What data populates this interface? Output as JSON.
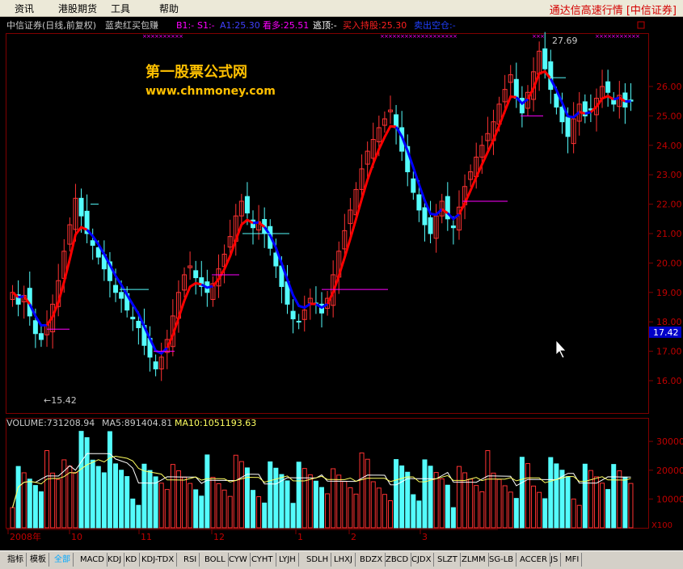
{
  "menu": {
    "items": [
      "资讯",
      "港股期货",
      "工具",
      "帮助"
    ],
    "brand": "通达信高速行情 [中信证券]"
  },
  "header": {
    "stock": "中信证券(日线,前复权)",
    "formula": "蓝卖红买包赚",
    "b1": "B1:-",
    "s1": "S1:-",
    "a1": "A1:25.30",
    "kanduo": "看多:25.51",
    "taoding": "逃顶:-",
    "mairu": "买入持股:25.30",
    "maichu": "卖出空仓:-"
  },
  "watermark": {
    "line1": "第一股票公式网",
    "line2": "www.chnmoney.com"
  },
  "annotations": {
    "high": "27.69",
    "low": "←15.42",
    "last_price": "17.42"
  },
  "price_axis": {
    "ticks": [
      "26.00",
      "25.00",
      "24.00",
      "23.00",
      "22.00",
      "21.00",
      "20.00",
      "19.00",
      "18.00",
      "17.00",
      "16.00"
    ]
  },
  "volume_header": {
    "volume": "VOLUME:731208.94",
    "ma5": "MA5:891404.81",
    "ma10": "MA10:1051193.63"
  },
  "volume_axis": {
    "ticks": [
      "30000",
      "20000",
      "10000"
    ],
    "unit": "X100"
  },
  "time_axis": {
    "labels": [
      "2008年",
      "10",
      "11",
      "12",
      "1",
      "2",
      "3"
    ]
  },
  "tabs": [
    "指标",
    "模板",
    "全部",
    "MACD",
    "KDJ",
    "KD",
    "KDJ-TDX",
    "RSI",
    "BOLL",
    "CYW",
    "CYHT",
    "LYJH",
    "SDLH",
    "LHXJ",
    "BDZX",
    "ZBCD",
    "CJDX",
    "SLZT",
    "ZLMM",
    "SG-LB",
    "ACCER",
    "JS",
    "MFI"
  ],
  "active_tab": "全部",
  "colors": {
    "up": "#ff3232",
    "down": "#54fcfc",
    "buy_line": "#ff0000",
    "sell_line": "#0000ff",
    "grid": "#800000",
    "axis_text": "#c00000"
  }
}
